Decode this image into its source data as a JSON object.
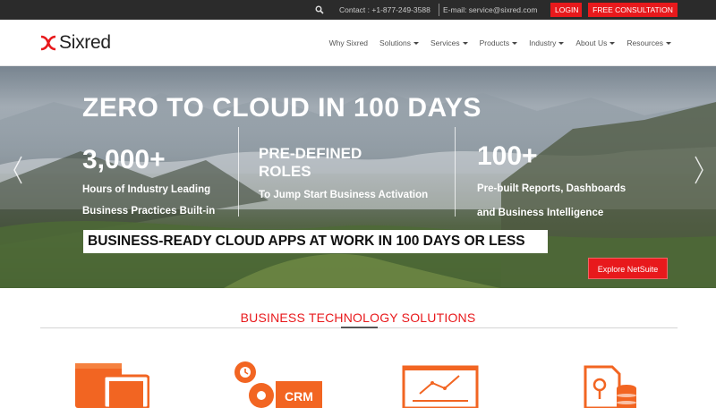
{
  "topbar": {
    "contact": "Contact : +1-877-249-3588",
    "email": "E-mail: service@sixred.com",
    "login_label": "LOGIN",
    "consultation_label": "FREE CONSULTATION",
    "icon": "search-icon"
  },
  "brand": {
    "name": "Sixred",
    "accent": "#e8191c"
  },
  "nav": {
    "items": [
      {
        "label": "Why Sixred",
        "dropdown": false
      },
      {
        "label": "Solutions",
        "dropdown": true
      },
      {
        "label": "Services",
        "dropdown": true
      },
      {
        "label": "Products",
        "dropdown": true
      },
      {
        "label": "Industry",
        "dropdown": true
      },
      {
        "label": "About Us",
        "dropdown": true
      },
      {
        "label": "Resources",
        "dropdown": true
      }
    ]
  },
  "hero": {
    "title": "ZERO TO CLOUD IN 100 DAYS",
    "stats": [
      {
        "big": "3,000+",
        "sub1": "Hours of Industry Leading",
        "sub2": "Business Practices Built-in"
      },
      {
        "big1": "PRE-DEFINED",
        "big2": "ROLES",
        "sub": "To Jump Start Business Activation"
      },
      {
        "big": "100+",
        "sub1": "Pre-built Reports, Dashboards",
        "sub2": "and Business Intelligence"
      }
    ],
    "banner": "BUSINESS-READY CLOUD APPS AT WORK IN 100 DAYS OR LESS",
    "cta_label": "Explore NetSuite"
  },
  "solutions": {
    "title": "BUSINESS TECHNOLOGY SOLUTIONS",
    "icons": [
      {
        "icon": "devices-icon"
      },
      {
        "icon": "crm-gear-icon",
        "label": "CRM"
      },
      {
        "icon": "analytics-chart-icon"
      },
      {
        "icon": "certificate-database-icon"
      }
    ],
    "icon_color": "#f26522"
  }
}
